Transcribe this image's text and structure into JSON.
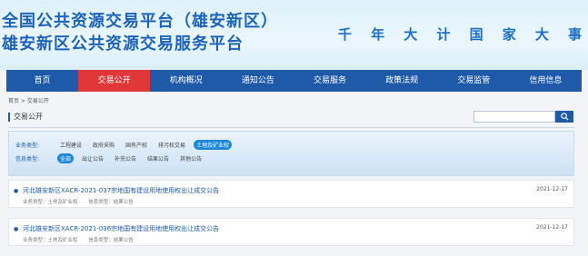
{
  "header": {
    "title_line1": "全国公共资源交易平台（雄安新区）",
    "title_line2": "雄安新区公共资源交易服务平台",
    "slogan": [
      "千",
      "年",
      "大",
      "计",
      "国",
      "家",
      "大",
      "事"
    ]
  },
  "nav": {
    "items": [
      "首页",
      "交易公开",
      "机构概况",
      "通知公告",
      "交易服务",
      "政策法规",
      "交易监管",
      "信用信息"
    ],
    "active_index": 1
  },
  "breadcrumb": "首页 > 交易公开",
  "section": {
    "title": "交易公开",
    "search_placeholder": "",
    "search_icon": "search-icon"
  },
  "filters": {
    "business": {
      "label": "业务类型:",
      "options": [
        "工程建设",
        "政府采购",
        "国有产权",
        "排污权交易",
        "土地及矿业权"
      ],
      "active_index": 4
    },
    "info": {
      "label": "信息类型:",
      "options": [
        "全部",
        "出让公告",
        "补充公告",
        "结果公告",
        "其他公告"
      ],
      "active_index": 0
    }
  },
  "list": [
    {
      "title": "河北雄安新区XACR-2021-037宗地国有建设用地使用权出让成交公告",
      "date": "2021-12-17",
      "business_type": "业务类型：土地及矿业权",
      "info_type": "信息类型：结果公告"
    },
    {
      "title": "河北雄安新区XACR-2021-036宗地国有建设用地使用权出让成交公告",
      "date": "2021-12-17",
      "business_type": "业务类型：土地及矿业权",
      "info_type": "信息类型：结果公告"
    }
  ],
  "colors": {
    "primary": "#1e5aa8",
    "accent": "#e03838",
    "highlight": "#1e88d8"
  }
}
